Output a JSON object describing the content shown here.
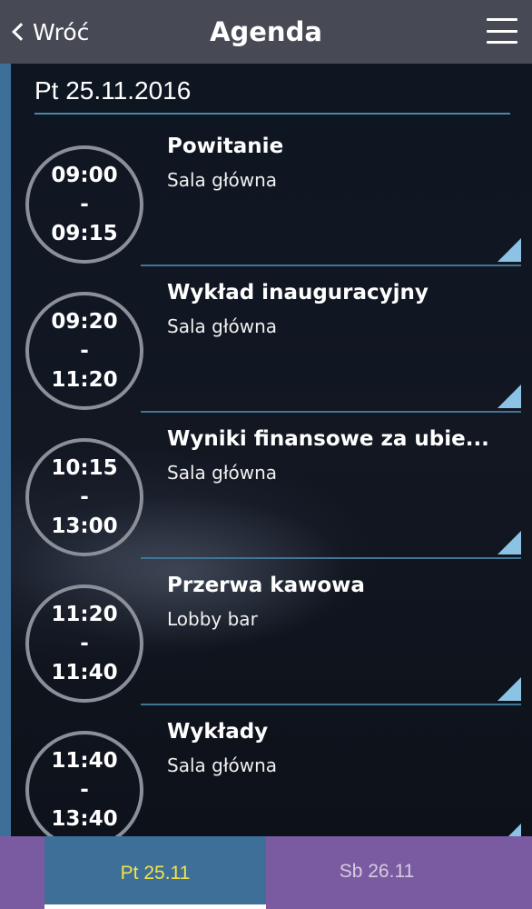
{
  "header": {
    "back_label": "Wróć",
    "title": "Agenda"
  },
  "day_heading": "Pt 25.11.2016",
  "sessions": [
    {
      "start": "09:00",
      "separator": "-",
      "end": "09:15",
      "title": "Powitanie",
      "room": "Sala główna"
    },
    {
      "start": "09:20",
      "separator": "-",
      "end": "11:20",
      "title": "Wykład inauguracyjny",
      "room": "Sala główna"
    },
    {
      "start": "10:15",
      "separator": "-",
      "end": "13:00",
      "title": "Wyniki finansowe za ubie...",
      "room": "Sala główna"
    },
    {
      "start": "11:20",
      "separator": "-",
      "end": "11:40",
      "title": "Przerwa kawowa",
      "room": "Lobby bar"
    },
    {
      "start": "11:40",
      "separator": "-",
      "end": "13:40",
      "title": "Wykłady",
      "room": "Sala główna"
    }
  ],
  "tabs": [
    {
      "label": "Pt 25.11",
      "active": true
    },
    {
      "label": "Sb 26.11",
      "active": false
    }
  ],
  "colors": {
    "header_bg": "#474a55",
    "accent_blue": "#3e6f99",
    "tabbar_bg": "#7a5aa1",
    "active_tab_text": "#f1e44a",
    "corner_icon": "#8cc3e4"
  }
}
